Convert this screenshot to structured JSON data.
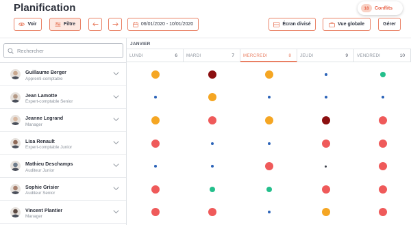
{
  "header": {
    "title": "Planification",
    "conflicts": {
      "count": "18",
      "label": "Conflits"
    }
  },
  "toolbar": {
    "voir": "Voir",
    "filtre": "Filtre",
    "date_range": "06/01/2020 - 10/01/2020",
    "ecran_divise": "Écran divisé",
    "vue_globale": "Vue globale",
    "gerer": "Gérer"
  },
  "search": {
    "placeholder": "Rechercher"
  },
  "calendar": {
    "month": "JANVIER",
    "days": [
      {
        "name": "LUNDI",
        "num": "6",
        "today": false
      },
      {
        "name": "MARDI",
        "num": "7",
        "today": false
      },
      {
        "name": "MERCREDI",
        "num": "8",
        "today": true
      },
      {
        "name": "JEUDI",
        "num": "9",
        "today": false
      },
      {
        "name": "VENDREDI",
        "num": "10",
        "today": false
      }
    ]
  },
  "people": [
    {
      "name": "Guillaume Berger",
      "role": "Apprenti-comptable",
      "avatar": "#c9a88f",
      "marks": [
        "orange",
        "darkred",
        "orange",
        "smallblue",
        "green"
      ]
    },
    {
      "name": "Jean Lamotte",
      "role": "Expert-comptable Senior",
      "avatar": "#b59a86",
      "marks": [
        "smallblue",
        "orange",
        "smallblue",
        "smallblue",
        "smallblue"
      ]
    },
    {
      "name": "Jeanne Legrand",
      "role": "Manager",
      "avatar": "#d9b8a0",
      "marks": [
        "orange",
        "red",
        "orange",
        "darkred",
        "red"
      ]
    },
    {
      "name": "Lisa Renault",
      "role": "Expert-comptable Junior",
      "avatar": "#8f6a58",
      "marks": [
        "red",
        "smallblue",
        "smallblue",
        "red",
        "red"
      ]
    },
    {
      "name": "Mathieu Deschamps",
      "role": "Auditeur Junior",
      "avatar": "#6f7d8c",
      "marks": [
        "smallblue",
        "smallblue",
        "red",
        "tinydark",
        "red"
      ]
    },
    {
      "name": "Sophie Grisier",
      "role": "Auditeur Senior",
      "avatar": "#a87f6c",
      "marks": [
        "red",
        "green",
        "green",
        "red",
        "red"
      ]
    },
    {
      "name": "Vincent Plantier",
      "role": "Manager",
      "avatar": "#5c4a42",
      "marks": [
        "red",
        "red",
        "smallblue",
        "orange",
        "red"
      ]
    }
  ],
  "mark_styles": {
    "orange": {
      "color": "#f5a623",
      "size": 12
    },
    "darkred": {
      "color": "#8b0f10",
      "size": 12
    },
    "red": {
      "color": "#ef5a5a",
      "size": 12
    },
    "green": {
      "color": "#24bf8c",
      "size": 8
    },
    "smallblue": {
      "color": "#2b63b8",
      "size": 4
    },
    "tinydark": {
      "color": "#3a3f4a",
      "size": 3
    }
  },
  "colors": {
    "accent": "#e97f63",
    "conflict_bg": "#f9d1c4"
  }
}
